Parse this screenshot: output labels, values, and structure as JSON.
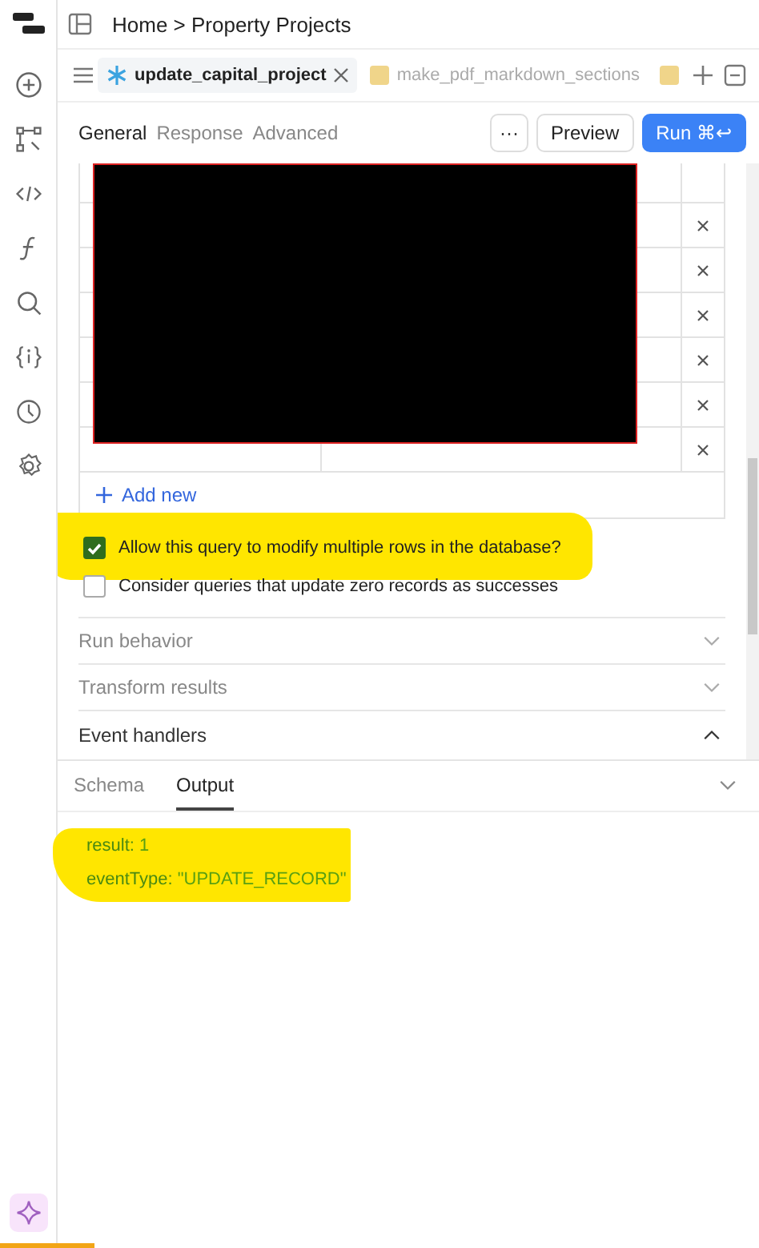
{
  "breadcrumb": "Home > Property Projects",
  "query_tabs": [
    {
      "label": "update_capital_project",
      "kind": "snowflake",
      "selected": true
    },
    {
      "label": "make_pdf_markdown_sections",
      "kind": "js",
      "selected": false
    },
    {
      "kind": "js",
      "selected": false
    }
  ],
  "section_tabs": [
    {
      "label": "General",
      "selected": true
    },
    {
      "label": "Response",
      "selected": false
    },
    {
      "label": "Advanced",
      "selected": false
    }
  ],
  "buttons": {
    "more": "···",
    "preview": "Preview",
    "run": "Run",
    "run_shortcut": "⌘↩"
  },
  "table": {
    "rows": [
      {
        "removable": false
      },
      {
        "removable": true
      },
      {
        "removable": true
      },
      {
        "removable": true
      },
      {
        "removable": true
      },
      {
        "removable": true
      },
      {
        "removable": true
      }
    ],
    "redacted": true,
    "add_label": "Add new"
  },
  "options": [
    {
      "label": "Allow this query to modify multiple rows in the database?",
      "checked": true,
      "highlighted": true
    },
    {
      "label": "Consider queries that update zero records as successes",
      "checked": false,
      "highlighted": false
    }
  ],
  "sections": [
    {
      "label": "Run behavior",
      "expanded": false
    },
    {
      "label": "Transform results",
      "expanded": false
    },
    {
      "label": "Event handlers",
      "expanded": true
    }
  ],
  "output_tabs": [
    {
      "label": "Schema",
      "selected": false
    },
    {
      "label": "Output",
      "selected": true
    }
  ],
  "output": {
    "highlighted": true,
    "lines": [
      {
        "key": "result:",
        "value": "1"
      },
      {
        "key": "eventType:",
        "value": "\"UPDATE_RECORD\""
      }
    ]
  }
}
